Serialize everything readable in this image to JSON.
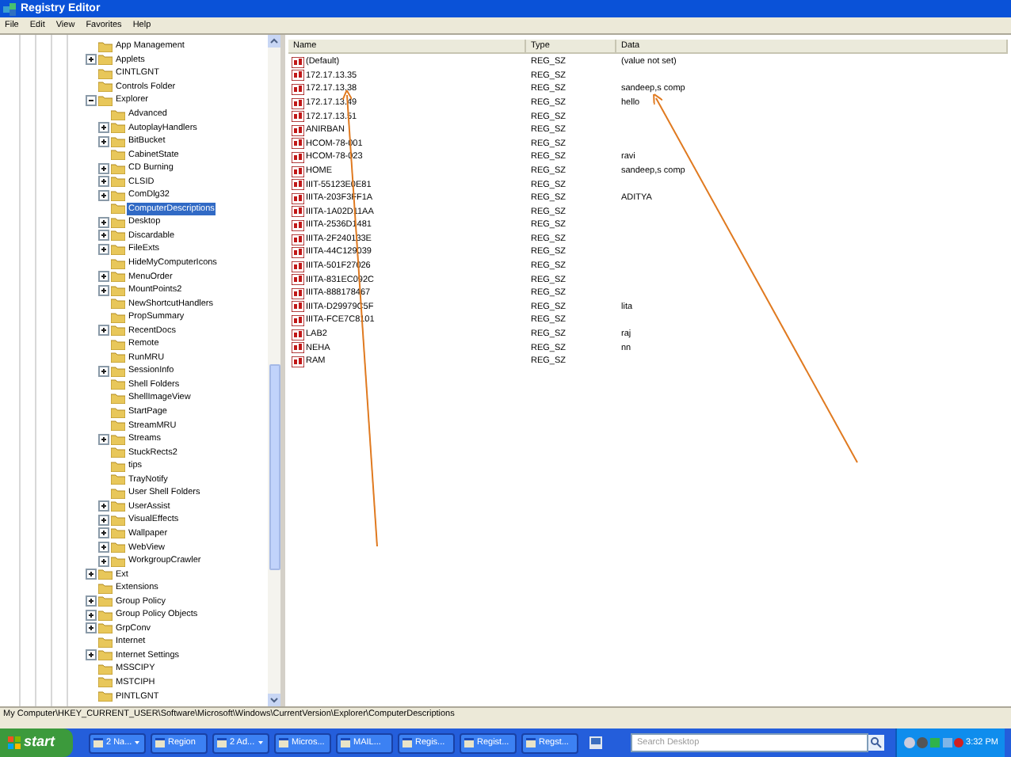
{
  "window": {
    "title": "Registry Editor"
  },
  "menu": [
    "File",
    "Edit",
    "View",
    "Favorites",
    "Help"
  ],
  "tree": [
    {
      "label": "App Management",
      "selected": false
    },
    {
      "label": "Applets",
      "selected": false,
      "expanded": false
    },
    {
      "label": "CINTLGNT",
      "selected": false
    },
    {
      "label": "Controls Folder",
      "selected": false
    },
    {
      "label": "Explorer",
      "selected": false,
      "expanded": true,
      "children": [
        {
          "label": "Advanced",
          "selected": false
        },
        {
          "label": "AutoplayHandlers",
          "selected": false,
          "expanded": false
        },
        {
          "label": "BitBucket",
          "selected": false,
          "expanded": false
        },
        {
          "label": "CabinetState",
          "selected": false
        },
        {
          "label": "CD Burning",
          "selected": false,
          "expanded": false
        },
        {
          "label": "CLSID",
          "selected": false,
          "expanded": false
        },
        {
          "label": "ComDlg32",
          "selected": false,
          "expanded": false
        },
        {
          "label": "ComputerDescriptions",
          "selected": true
        },
        {
          "label": "Desktop",
          "selected": false,
          "expanded": false
        },
        {
          "label": "Discardable",
          "selected": false,
          "expanded": false
        },
        {
          "label": "FileExts",
          "selected": false,
          "expanded": false
        },
        {
          "label": "HideMyComputerIcons",
          "selected": false
        },
        {
          "label": "MenuOrder",
          "selected": false,
          "expanded": false
        },
        {
          "label": "MountPoints2",
          "selected": false,
          "expanded": false
        },
        {
          "label": "NewShortcutHandlers",
          "selected": false
        },
        {
          "label": "PropSummary",
          "selected": false
        },
        {
          "label": "RecentDocs",
          "selected": false,
          "expanded": false
        },
        {
          "label": "Remote",
          "selected": false
        },
        {
          "label": "RunMRU",
          "selected": false
        },
        {
          "label": "SessionInfo",
          "selected": false,
          "expanded": false
        },
        {
          "label": "Shell Folders",
          "selected": false
        },
        {
          "label": "ShellImageView",
          "selected": false
        },
        {
          "label": "StartPage",
          "selected": false
        },
        {
          "label": "StreamMRU",
          "selected": false
        },
        {
          "label": "Streams",
          "selected": false,
          "expanded": false
        },
        {
          "label": "StuckRects2",
          "selected": false
        },
        {
          "label": "tips",
          "selected": false
        },
        {
          "label": "TrayNotify",
          "selected": false
        },
        {
          "label": "User Shell Folders",
          "selected": false
        },
        {
          "label": "UserAssist",
          "selected": false,
          "expanded": false
        },
        {
          "label": "VisualEffects",
          "selected": false,
          "expanded": false
        },
        {
          "label": "Wallpaper",
          "selected": false,
          "expanded": false
        },
        {
          "label": "WebView",
          "selected": false,
          "expanded": false
        },
        {
          "label": "WorkgroupCrawler",
          "selected": false,
          "expanded": false
        }
      ]
    },
    {
      "label": "Ext",
      "selected": false,
      "expanded": false
    },
    {
      "label": "Extensions",
      "selected": false
    },
    {
      "label": "Group Policy",
      "selected": false,
      "expanded": false
    },
    {
      "label": "Group Policy Objects",
      "selected": false,
      "expanded": false
    },
    {
      "label": "GrpConv",
      "selected": false,
      "expanded": false
    },
    {
      "label": "Internet",
      "selected": false
    },
    {
      "label": "Internet Settings",
      "selected": false,
      "expanded": false
    },
    {
      "label": "MSSCIPY",
      "selected": false
    },
    {
      "label": "MSTCIPH",
      "selected": false
    },
    {
      "label": "PINTLGNT",
      "selected": false
    }
  ],
  "table": {
    "columns": [
      "Name",
      "Type",
      "Data"
    ],
    "rows": [
      {
        "name": "(Default)",
        "type": "REG_SZ",
        "data": "(value not set)"
      },
      {
        "name": "172.17.13.35",
        "type": "REG_SZ"
      },
      {
        "name": "172.17.13.38",
        "type": "REG_SZ",
        "data": "sandeep,s comp"
      },
      {
        "name": "172.17.13.49",
        "type": "REG_SZ",
        "data": "hello"
      },
      {
        "name": "172.17.13.51",
        "type": "REG_SZ"
      },
      {
        "name": "ANIRBAN",
        "type": "REG_SZ"
      },
      {
        "name": "HCOM-78-001",
        "type": "REG_SZ"
      },
      {
        "name": "HCOM-78-023",
        "type": "REG_SZ",
        "data": "ravi"
      },
      {
        "name": "HOME",
        "type": "REG_SZ",
        "data": "sandeep,s comp"
      },
      {
        "name": "IIIT-55123E0E81",
        "type": "REG_SZ"
      },
      {
        "name": "IIITA-203F3FF1A",
        "type": "REG_SZ",
        "data": "ADITYA"
      },
      {
        "name": "IIITA-1A02D11AA",
        "type": "REG_SZ"
      },
      {
        "name": "IIITA-2536D1481",
        "type": "REG_SZ"
      },
      {
        "name": "IIITA-2F240133E",
        "type": "REG_SZ"
      },
      {
        "name": "IIITA-44C129039",
        "type": "REG_SZ"
      },
      {
        "name": "IIITA-501F27026",
        "type": "REG_SZ"
      },
      {
        "name": "IIITA-831EC092C",
        "type": "REG_SZ"
      },
      {
        "name": "IIITA-888178467",
        "type": "REG_SZ"
      },
      {
        "name": "IIITA-D29979C5F",
        "type": "REG_SZ",
        "data": "lita"
      },
      {
        "name": "IIITA-FCE7C8101",
        "type": "REG_SZ"
      },
      {
        "name": "LAB2",
        "type": "REG_SZ",
        "data": "raj"
      },
      {
        "name": "NEHA",
        "type": "REG_SZ",
        "data": "nn"
      },
      {
        "name": "RAM",
        "type": "REG_SZ"
      }
    ]
  },
  "status_bar": "My Computer\\HKEY_CURRENT_USER\\Software\\Microsoft\\Windows\\CurrentVersion\\Explorer\\ComputerDescriptions",
  "taskbar": {
    "start": "start",
    "tasks": [
      {
        "label": "2 Na...",
        "group": true
      },
      {
        "label": "Region",
        "group": false
      },
      {
        "label": "2 Ad...",
        "group": true
      },
      {
        "label": "Micros...",
        "group": false
      },
      {
        "label": "MAIL...",
        "group": false
      },
      {
        "label": "Regis...",
        "group": false
      },
      {
        "label": "Regist...",
        "group": false
      },
      {
        "label": "Regst...",
        "group": false
      }
    ],
    "search": {
      "placeholder": "Search Desktop"
    },
    "clock": "3:32 PM"
  }
}
